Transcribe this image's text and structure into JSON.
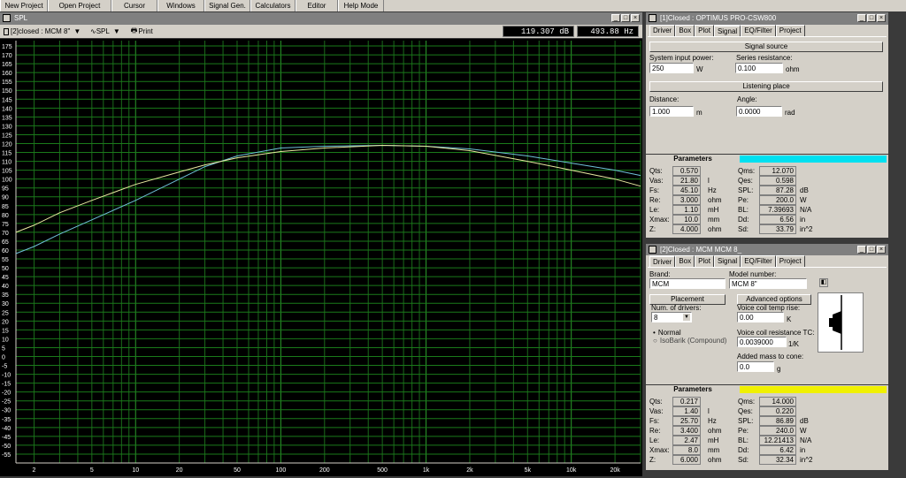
{
  "menu": [
    "New Project",
    "Open Project",
    "Cursor",
    "Windows",
    "Signal Gen.",
    "Calculators",
    "Editor",
    "Help Mode"
  ],
  "spl": {
    "title": "SPL",
    "driver_select": "[2]closed : MCM 8\"",
    "view_select": "SPL",
    "print": "Print",
    "readout_db": "119.307 dB",
    "readout_hz": "493.88 Hz",
    "y_ticks": [
      "175",
      "170",
      "165",
      "160",
      "155",
      "150",
      "145",
      "140",
      "135",
      "130",
      "125",
      "120",
      "115",
      "110",
      "105",
      "100",
      "95",
      "90",
      "85",
      "80",
      "75",
      "70",
      "65",
      "60",
      "55",
      "50",
      "45",
      "40",
      "35",
      "30",
      "25",
      "20",
      "15",
      "10",
      "5",
      "0",
      "-5",
      "-10",
      "-15",
      "-20",
      "-25",
      "-30",
      "-35",
      "-40",
      "-45",
      "-50",
      "-55"
    ],
    "x_ticks": [
      "2",
      "5",
      "10",
      "20",
      "50",
      "100",
      "200",
      "500",
      "1k",
      "2k",
      "5k",
      "10k",
      "20k"
    ]
  },
  "chart_data": {
    "type": "line",
    "xscale": "log",
    "xlim": [
      1.5,
      30000
    ],
    "ylim": [
      -60,
      178
    ],
    "grid": true,
    "series": [
      {
        "color": "#6fc0d8",
        "x": [
          1.5,
          2,
          3,
          5,
          10,
          20,
          30,
          50,
          100,
          200,
          500,
          1000,
          2000,
          5000,
          10000,
          20000,
          30000
        ],
        "y": [
          58,
          62,
          69,
          77,
          88,
          100,
          107,
          113,
          117.5,
          118.5,
          119,
          118.5,
          117,
          113,
          109,
          105,
          102
        ]
      },
      {
        "color": "#e8e8a0",
        "x": [
          1.5,
          2,
          3,
          5,
          10,
          20,
          30,
          50,
          100,
          200,
          500,
          1000,
          2000,
          5000,
          10000,
          20000,
          30000
        ],
        "y": [
          70,
          74,
          81,
          88,
          97,
          104,
          108,
          112,
          115.5,
          117.5,
          119,
          118.5,
          116,
          110,
          105,
          100,
          96
        ]
      }
    ]
  },
  "optimus": {
    "title": "[1]Closed : OPTIMUS PRO-CSW800",
    "tabs": [
      "Driver",
      "Box",
      "Plot",
      "Signal",
      "EQ/Filter",
      "Project"
    ],
    "signal_source": "Signal source",
    "sys_power_label": "System input power:",
    "sys_power": "250",
    "sys_power_unit": "W",
    "series_res_label": "Series resistance:",
    "series_res": "0.100",
    "series_res_unit": "ohm",
    "listening": "Listening place",
    "distance_label": "Distance:",
    "distance": "1.000",
    "distance_unit": "m",
    "angle_label": "Angle:",
    "angle": "0.0000",
    "angle_unit": "rad",
    "params_title": "Parameters",
    "params_color": "#00e0f0",
    "left": [
      [
        "Qts:",
        "0.570",
        ""
      ],
      [
        "Vas:",
        "21.80",
        "l"
      ],
      [
        "Fs:",
        "45.10",
        "Hz"
      ],
      [
        "Re:",
        "3.000",
        "ohm"
      ],
      [
        "Le:",
        "1.10",
        "mH"
      ],
      [
        "Xmax:",
        "10.0",
        "mm"
      ],
      [
        "Z:",
        "4.000",
        "ohm"
      ]
    ],
    "right": [
      [
        "Qms:",
        "12.070",
        ""
      ],
      [
        "Qes:",
        "0.598",
        ""
      ],
      [
        "SPL:",
        "87.28",
        "dB"
      ],
      [
        "Pe:",
        "200.0",
        "W"
      ],
      [
        "BL:",
        "7.39693",
        "N/A"
      ],
      [
        "Dd:",
        "6.56",
        "in"
      ],
      [
        "Sd:",
        "33.79",
        "in^2"
      ]
    ]
  },
  "mcm": {
    "title": "[2]Closed : MCM MCM 8_",
    "tabs": [
      "Driver",
      "Box",
      "Plot",
      "Signal",
      "EQ/Filter",
      "Project"
    ],
    "brand_label": "Brand:",
    "brand": "MCM",
    "model_label": "Model number:",
    "model": "MCM 8\"",
    "placement": "Placement",
    "advanced": "Advanced options",
    "num_drivers_label": "Num. of drivers:",
    "num_drivers": "8",
    "vc_temp_label": "Voice coil temp rise:",
    "vc_temp": "0.00",
    "vc_temp_unit": "K",
    "normal": "Normal",
    "isobarik": "IsoBarik (Compound)",
    "vc_res_label": "Voice coil resistance TC:",
    "vc_res": "0.0039000",
    "vc_res_unit": "1/K",
    "mass_label": "Added mass to cone:",
    "mass": "0.0",
    "mass_unit": "g",
    "params_title": "Parameters",
    "params_color": "#f0f000",
    "left": [
      [
        "Qts:",
        "0.217",
        ""
      ],
      [
        "Vas:",
        "1.40",
        "l"
      ],
      [
        "Fs:",
        "25.70",
        "Hz"
      ],
      [
        "Re:",
        "3.400",
        "ohm"
      ],
      [
        "Le:",
        "2.47",
        "mH"
      ],
      [
        "Xmax:",
        "8.0",
        "mm"
      ],
      [
        "Z:",
        "6.000",
        "ohm"
      ]
    ],
    "right": [
      [
        "Qms:",
        "14.000",
        ""
      ],
      [
        "Qes:",
        "0.220",
        ""
      ],
      [
        "SPL:",
        "86.89",
        "dB"
      ],
      [
        "Pe:",
        "240.0",
        "W"
      ],
      [
        "BL:",
        "12.21413",
        "N/A"
      ],
      [
        "Dd:",
        "6.42",
        "in"
      ],
      [
        "Sd:",
        "32.34",
        "in^2"
      ]
    ]
  }
}
